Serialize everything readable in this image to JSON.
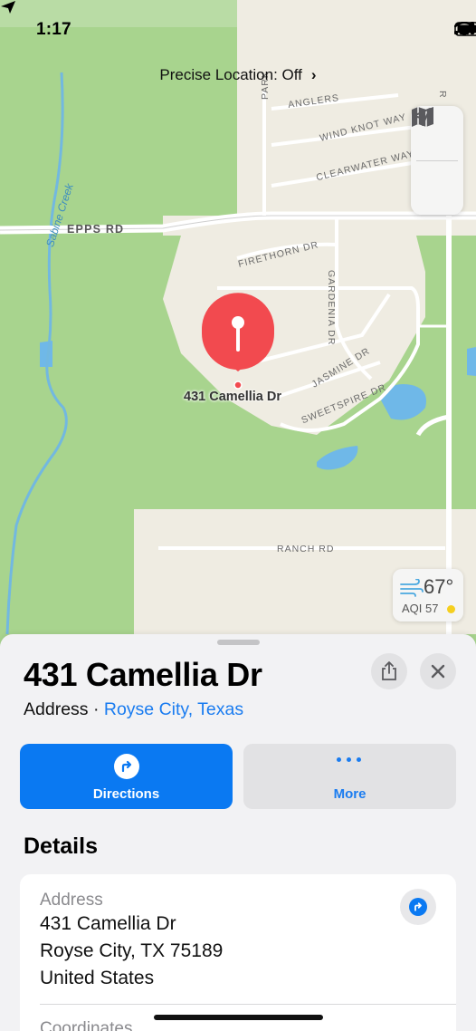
{
  "status_bar": {
    "time": "1:17"
  },
  "map": {
    "precise_location": "Precise Location: Off",
    "pin_label": "431 Camellia Dr",
    "roads": {
      "epps": "EPPS RD",
      "park": "PARK",
      "anglers": "ANGLERS",
      "wind_knot": "WIND KNOT WAY",
      "clearwater": "CLEARWATER WAY",
      "firethorn": "FIRETHORN DR",
      "gardenia": "GARDENIA DR",
      "jasmine": "JASMINE DR",
      "sweetspire": "SWEETSPIRE DR",
      "ranch": "RANCH RD",
      "edge_r": "R"
    },
    "creek": "Sabine Creek",
    "weather": {
      "temp": "67°",
      "aqi": "AQI 57"
    },
    "icons": [
      "map-mode-icon",
      "location-arrow-icon",
      "wind-icon"
    ]
  },
  "sheet": {
    "title": "431 Camellia Dr",
    "subtitle_prefix": "Address · ",
    "subtitle_link": "Royse City, Texas",
    "actions": {
      "directions": "Directions",
      "more": "More"
    },
    "details_heading": "Details",
    "address_card": {
      "label": "Address",
      "line1": "431 Camellia Dr",
      "line2": "Royse City, TX  75189",
      "line3": "United States",
      "next_label": "Coordinates"
    }
  },
  "colors": {
    "accent": "#0a79f2",
    "pin": "#f24a4f",
    "park": "#a8d48e",
    "land": "#efece2"
  }
}
